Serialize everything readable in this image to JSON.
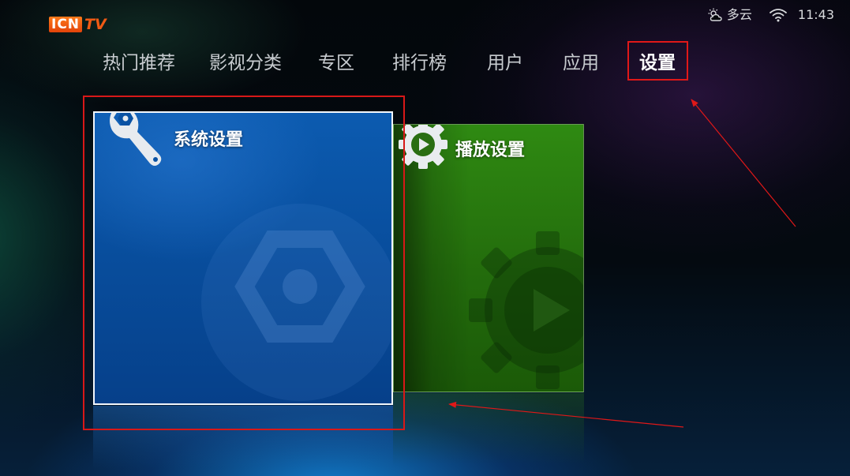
{
  "logo": {
    "brand": "ICN",
    "suffix": "TV"
  },
  "status_bar": {
    "weather_icon": "partly-cloudy-icon",
    "weather_text": "多云",
    "wifi_icon": "wifi-icon",
    "time": "11:43"
  },
  "nav": {
    "items": [
      {
        "label": "热门推荐"
      },
      {
        "label": "影视分类"
      },
      {
        "label": "专区"
      },
      {
        "label": "排行榜"
      },
      {
        "label": "用户"
      },
      {
        "label": "应用"
      },
      {
        "label": "设置"
      }
    ],
    "active_label": "设置"
  },
  "tiles": {
    "system": {
      "label": "系统设置",
      "icon": "wrench-icon",
      "color": "#0a52a3"
    },
    "play": {
      "label": "播放设置",
      "icon": "gear-play-icon",
      "color": "#2a7d10"
    }
  },
  "annotations": {
    "highlight_color": "#e01818"
  }
}
